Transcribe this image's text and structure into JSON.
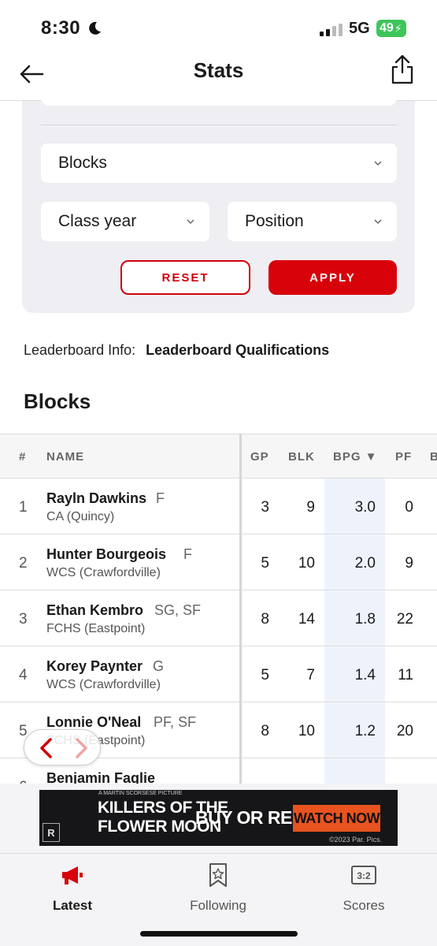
{
  "status_bar": {
    "time": "8:30",
    "network": "5G",
    "battery": "49"
  },
  "nav": {
    "title": "Stats"
  },
  "filters": {
    "stat_select": "Blocks",
    "class_year_select": "Class year",
    "position_select": "Position",
    "reset_label": "RESET",
    "apply_label": "APPLY"
  },
  "leaderboard_info": {
    "label": "Leaderboard Info:",
    "link": "Leaderboard Qualifications"
  },
  "section_title": "Blocks",
  "table": {
    "headers": {
      "rank": "#",
      "name": "NAME",
      "gp": "GP",
      "blk": "BLK",
      "bpg": "BPG ▼",
      "pf": "PF",
      "more": "B"
    },
    "rows": [
      {
        "rank": "1",
        "name": "Rayln Dawkins",
        "pos": "F",
        "team": "CA (Quincy)",
        "gp": "3",
        "blk": "9",
        "bpg": "3.0",
        "pf": "0"
      },
      {
        "rank": "2",
        "name": "Hunter Bourgeois",
        "pos": "F",
        "team": "WCS (Crawfordville)",
        "gp": "5",
        "blk": "10",
        "bpg": "2.0",
        "pf": "9"
      },
      {
        "rank": "3",
        "name": "Ethan Kembro",
        "pos": "SG, SF",
        "team": "FCHS (Eastpoint)",
        "gp": "8",
        "blk": "14",
        "bpg": "1.8",
        "pf": "22"
      },
      {
        "rank": "4",
        "name": "Korey Paynter",
        "pos": "G",
        "team": "WCS (Crawfordville)",
        "gp": "5",
        "blk": "7",
        "bpg": "1.4",
        "pf": "11"
      },
      {
        "rank": "5",
        "name": "Lonnie O'Neal",
        "pos": "PF, SF",
        "team": "FCHS (Eastpoint)",
        "gp": "8",
        "blk": "10",
        "bpg": "1.2",
        "pf": "20"
      },
      {
        "rank": "6",
        "name": "Benjamin Faglie",
        "pos": "",
        "team": "",
        "gp": "",
        "blk": "",
        "bpg": "",
        "pf": ""
      }
    ]
  },
  "ad": {
    "tagline": "A MARTIN SCORSESE PICTURE",
    "title": "KILLERS OF THE\nFLOWER MOON",
    "buy": "BUY OR RENT",
    "cta": "WATCH NOW",
    "copyright": "©2023 Par. Pics.",
    "rating": "R"
  },
  "tabs": [
    {
      "label": "Latest",
      "icon": "megaphone-icon",
      "active": true
    },
    {
      "label": "Following",
      "icon": "bookmark-star-icon",
      "active": false
    },
    {
      "label": "Scores",
      "icon": "scoreboard-icon",
      "active": false
    }
  ],
  "colors": {
    "accent": "#d8020b",
    "panel": "#efeff3",
    "bpg_highlight": "#eef3fb",
    "battery": "#3ec55a",
    "ad_cta": "#e8531f"
  }
}
